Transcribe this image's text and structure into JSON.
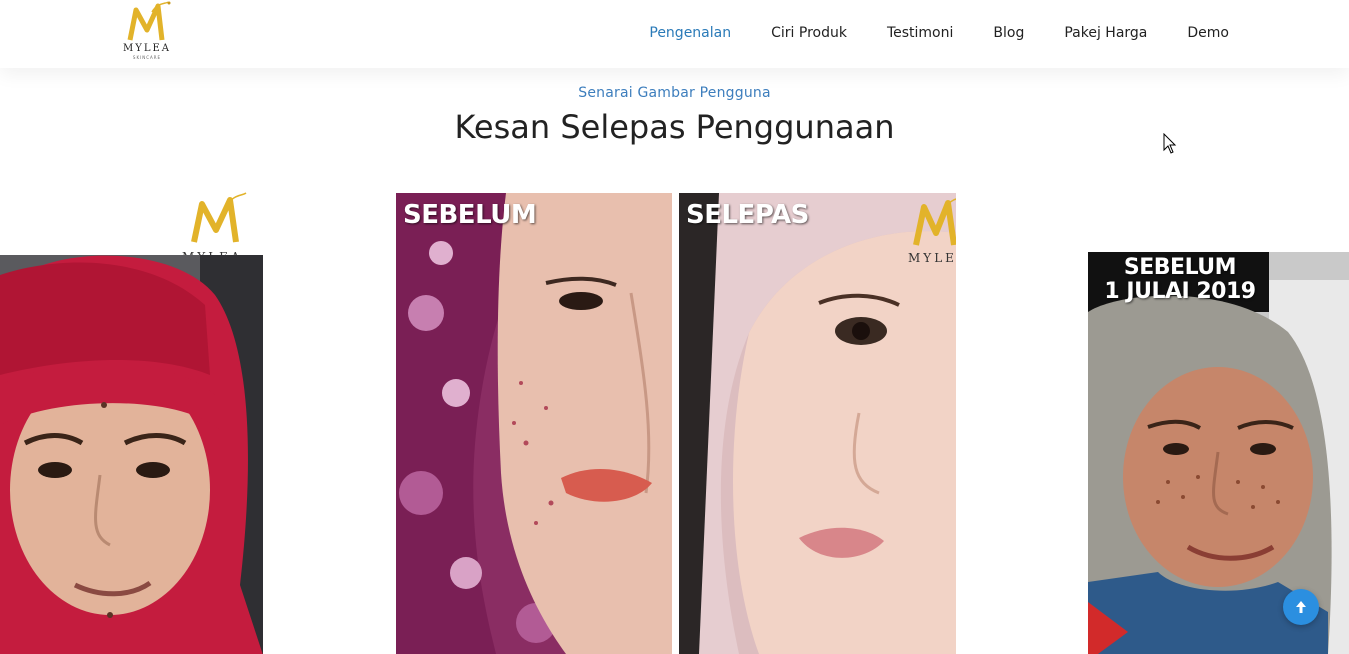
{
  "header": {
    "logo_text": "MYLEA",
    "logo_sub": "SKINCARE",
    "nav": [
      {
        "label": "Pengenalan",
        "active": true
      },
      {
        "label": "Ciri Produk",
        "active": false
      },
      {
        "label": "Testimoni",
        "active": false
      },
      {
        "label": "Blog",
        "active": false
      },
      {
        "label": "Pakej Harga",
        "active": false
      },
      {
        "label": "Demo",
        "active": false
      }
    ]
  },
  "section": {
    "eyebrow": "Senarai Gambar Pengguna",
    "title": "Kesan Selepas Penggunaan"
  },
  "slides": {
    "left": {
      "watermark": "MYLEA"
    },
    "center": {
      "before_label": "SEBELUM",
      "after_label": "SELEPAS",
      "watermark": "MYLEA"
    },
    "right": {
      "label_line1": "SEBELUM",
      "label_line2": "1 JULAI 2019"
    }
  },
  "colors": {
    "accent": "#2a7ab8",
    "eyebrow": "#3d7ebd",
    "scroll_button": "#2b8fe0",
    "logo_gold": "#e2b32a"
  },
  "icons": {
    "scroll_top": "arrow-up-icon",
    "logo": "mylea-logo"
  }
}
